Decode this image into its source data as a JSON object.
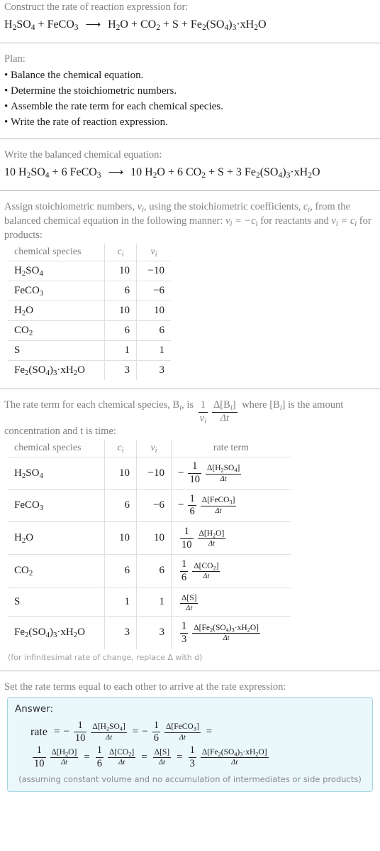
{
  "steps": {
    "title_prompt": "Construct the rate of reaction expression for:",
    "unbalanced_equation": {
      "reactants": "H2SO4 + FeCO3",
      "products": "H2O + CO2 + S + Fe2(SO4)3·xH2O",
      "arrow": "⟶"
    },
    "plan": {
      "label": "Plan:",
      "items": [
        "Balance the chemical equation.",
        "Determine the stoichiometric numbers.",
        "Assemble the rate term for each chemical species.",
        "Write the rate of reaction expression."
      ]
    },
    "balanced": {
      "prompt": "Write the balanced chemical equation:",
      "reactants": "10 H2SO4 + 6 FeCO3",
      "products": "10 H2O + 6 CO2 + S + 3 Fe2(SO4)3·xH2O"
    },
    "stoich_prompt": {
      "part1": "Assign stoichiometric numbers, ",
      "nu_i": "νi",
      "part2": ", using the stoichiometric coefficients, ",
      "c_i": "ci",
      "part3": ", from the balanced chemical equation in the following manner: ",
      "rule_reactants": "νi = −ci",
      "part4": " for reactants and ",
      "rule_products": "νi = ci",
      "part5": " for products:"
    },
    "rate_term_prompt": {
      "part1": "The rate term for each chemical species, ",
      "b_i": "Bi",
      "part2": ", is ",
      "formula_num": "Δ[Bi]",
      "formula_den": "Δt",
      "coef_num": "1",
      "coef_den": "νi",
      "part3": " where [Bi] is the amount concentration and t is time:"
    },
    "infinitesimal_note": "(for infinitesimal rate of change, replace Δ with d)",
    "final_prompt": "Set the rate terms equal to each other to arrive at the rate expression:"
  },
  "table1": {
    "headers": [
      "chemical species",
      "ci",
      "νi"
    ],
    "rows": [
      {
        "species": "H2SO4",
        "c": "10",
        "v": "−10"
      },
      {
        "species": "FeCO3",
        "c": "6",
        "v": "−6"
      },
      {
        "species": "H2O",
        "c": "10",
        "v": "10"
      },
      {
        "species": "CO2",
        "c": "6",
        "v": "6"
      },
      {
        "species": "S",
        "c": "1",
        "v": "1"
      },
      {
        "species": "Fe2(SO4)3·xH2O",
        "c": "3",
        "v": "3"
      }
    ]
  },
  "table2": {
    "headers": [
      "chemical species",
      "ci",
      "νi",
      "rate term"
    ],
    "rows": [
      {
        "species": "H2SO4",
        "c": "10",
        "v": "−10",
        "sign": "−",
        "coef_num": "1",
        "coef_den": "10",
        "delta_num": "Δ[H2SO4]",
        "delta_den": "Δt"
      },
      {
        "species": "FeCO3",
        "c": "6",
        "v": "−6",
        "sign": "−",
        "coef_num": "1",
        "coef_den": "6",
        "delta_num": "Δ[FeCO3]",
        "delta_den": "Δt"
      },
      {
        "species": "H2O",
        "c": "10",
        "v": "10",
        "sign": "",
        "coef_num": "1",
        "coef_den": "10",
        "delta_num": "Δ[H2O]",
        "delta_den": "Δt"
      },
      {
        "species": "CO2",
        "c": "6",
        "v": "6",
        "sign": "",
        "coef_num": "1",
        "coef_den": "6",
        "delta_num": "Δ[CO2]",
        "delta_den": "Δt"
      },
      {
        "species": "S",
        "c": "1",
        "v": "1",
        "sign": "",
        "coef_num": "",
        "coef_den": "",
        "delta_num": "Δ[S]",
        "delta_den": "Δt"
      },
      {
        "species": "Fe2(SO4)3·xH2O",
        "c": "3",
        "v": "3",
        "sign": "",
        "coef_num": "1",
        "coef_den": "3",
        "delta_num": "Δ[Fe2(SO4)3·xH2O]",
        "delta_den": "Δt"
      }
    ]
  },
  "answer": {
    "label": "Answer:",
    "rate_word": "rate",
    "equals": "=",
    "terms": [
      {
        "sign": "−",
        "coef_num": "1",
        "coef_den": "10",
        "delta_num": "Δ[H2SO4]",
        "delta_den": "Δt"
      },
      {
        "sign": "−",
        "coef_num": "1",
        "coef_den": "6",
        "delta_num": "Δ[FeCO3]",
        "delta_den": "Δt"
      },
      {
        "sign": "",
        "coef_num": "1",
        "coef_den": "10",
        "delta_num": "Δ[H2O]",
        "delta_den": "Δt"
      },
      {
        "sign": "",
        "coef_num": "1",
        "coef_den": "6",
        "delta_num": "Δ[CO2]",
        "delta_den": "Δt"
      },
      {
        "sign": "",
        "coef_num": "",
        "coef_den": "",
        "delta_num": "Δ[S]",
        "delta_den": "Δt"
      },
      {
        "sign": "",
        "coef_num": "1",
        "coef_den": "3",
        "delta_num": "Δ[Fe2(SO4)3·xH2O]",
        "delta_den": "Δt"
      }
    ],
    "assumption": "(assuming constant volume and no accumulation of intermediates or side products)"
  },
  "colors": {
    "prompt_text": "#808080",
    "body_text": "#1a1a1a",
    "divider": "#b9b9b9",
    "table_border": "#dfdfdf",
    "answer_bg": "#eaf7fb",
    "answer_border": "#a3d4e0",
    "muted_note": "#a0a0a0"
  }
}
